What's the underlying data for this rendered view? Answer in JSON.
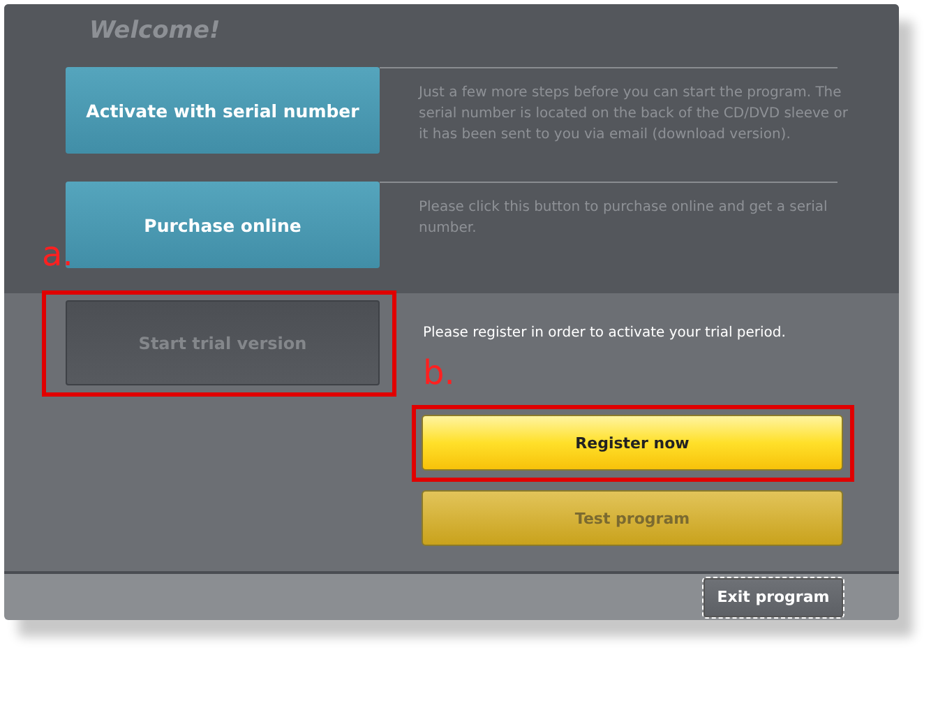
{
  "window": {
    "title": "Welcome!"
  },
  "options": [
    {
      "label": "Activate with serial number",
      "description": "Just a few more steps before you can start the program. The serial number is located on the back of the CD/DVD sleeve or it has been sent to you via email (download version)."
    },
    {
      "label": "Purchase online",
      "description": "Please click this button to purchase online and get a serial number."
    }
  ],
  "trial": {
    "button": {
      "label": "Start trial version",
      "disabled": true
    },
    "note": "Please register in order to activate your trial period.",
    "register_button": {
      "label": "Register now",
      "disabled": false
    },
    "test_button": {
      "label": "Test program",
      "disabled": true
    }
  },
  "footer": {
    "exit_button": {
      "label": "Exit program",
      "focused": true
    }
  },
  "annotations": [
    {
      "label": "a."
    },
    {
      "label": "b."
    }
  ]
}
